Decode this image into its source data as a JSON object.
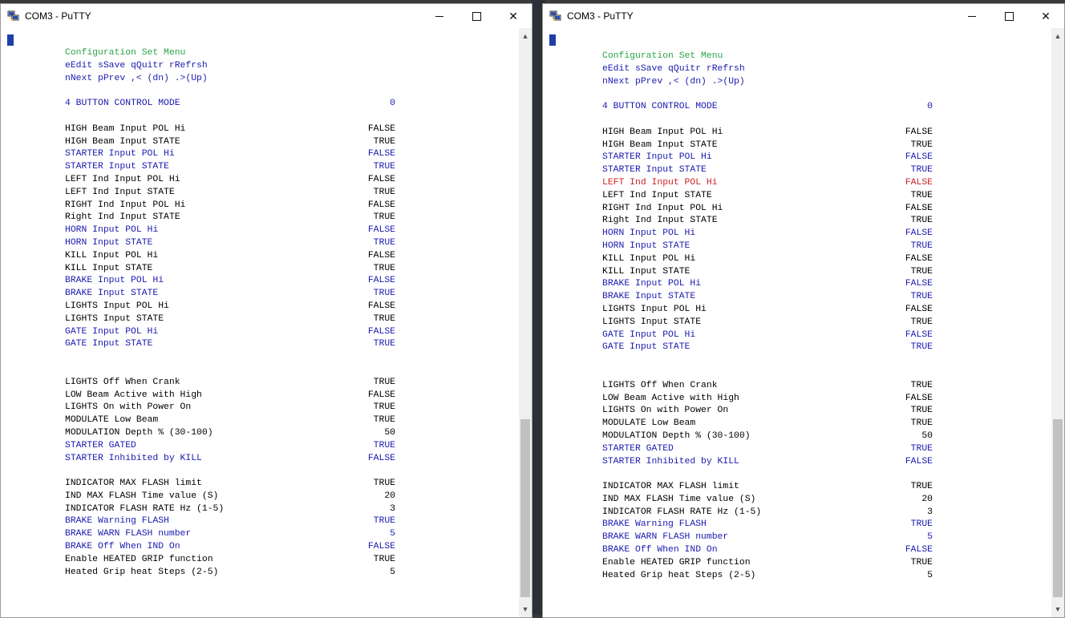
{
  "windows": [
    {
      "title": "COM3 - PuTTY",
      "lines_header": [
        {
          "text": "Configuration Set Menu",
          "color": "green"
        },
        {
          "text": "eEdit sSave qQuitr rRefrsh",
          "color": "blue"
        },
        {
          "text": "nNext pPrev ,< (dn) .>(Up)",
          "color": "blue"
        }
      ],
      "rows": [
        {
          "label": "",
          "value": ""
        },
        {
          "label": "4 BUTTON CONTROL MODE",
          "value": "0",
          "color": "blue"
        },
        {
          "label": "",
          "value": ""
        },
        {
          "label": "HIGH Beam Input POL Hi",
          "value": "FALSE",
          "color": "black"
        },
        {
          "label": "HIGH Beam Input STATE",
          "value": "TRUE",
          "color": "black"
        },
        {
          "label": "STARTER Input POL Hi",
          "value": "FALSE",
          "color": "blue"
        },
        {
          "label": "STARTER Input STATE",
          "value": "TRUE",
          "color": "blue"
        },
        {
          "label": "LEFT Ind Input POL Hi",
          "value": "FALSE",
          "color": "black"
        },
        {
          "label": "LEFT Ind Input STATE",
          "value": "TRUE",
          "color": "black"
        },
        {
          "label": "RIGHT Ind Input POL Hi",
          "value": "FALSE",
          "color": "black"
        },
        {
          "label": "Right Ind Input STATE",
          "value": "TRUE",
          "color": "black"
        },
        {
          "label": "HORN Input POL Hi",
          "value": "FALSE",
          "color": "blue"
        },
        {
          "label": "HORN Input STATE",
          "value": "TRUE",
          "color": "blue"
        },
        {
          "label": "KILL Input POL Hi",
          "value": "FALSE",
          "color": "black"
        },
        {
          "label": "KILL Input STATE",
          "value": "TRUE",
          "color": "black"
        },
        {
          "label": "BRAKE Input POL Hi",
          "value": "FALSE",
          "color": "blue"
        },
        {
          "label": "BRAKE Input STATE",
          "value": "TRUE",
          "color": "blue"
        },
        {
          "label": "LIGHTS Input POL Hi",
          "value": "FALSE",
          "color": "black"
        },
        {
          "label": "LIGHTS Input STATE",
          "value": "TRUE",
          "color": "black"
        },
        {
          "label": "GATE Input POL Hi",
          "value": "FALSE",
          "color": "blue"
        },
        {
          "label": "GATE Input STATE",
          "value": "TRUE",
          "color": "blue"
        },
        {
          "label": "",
          "value": ""
        },
        {
          "label": "",
          "value": ""
        },
        {
          "label": "LIGHTS Off When Crank",
          "value": "TRUE",
          "color": "black"
        },
        {
          "label": "LOW Beam Active with High",
          "value": "FALSE",
          "color": "black"
        },
        {
          "label": "LIGHTS On with Power On",
          "value": "TRUE",
          "color": "black"
        },
        {
          "label": "MODULATE Low Beam",
          "value": "TRUE",
          "color": "black"
        },
        {
          "label": "MODULATION Depth % (30-100)",
          "value": "50",
          "color": "black"
        },
        {
          "label": "STARTER GATED",
          "value": "TRUE",
          "color": "blue"
        },
        {
          "label": "STARTER Inhibited by KILL",
          "value": "FALSE",
          "color": "blue"
        },
        {
          "label": "",
          "value": ""
        },
        {
          "label": "INDICATOR MAX FLASH limit",
          "value": "TRUE",
          "color": "black"
        },
        {
          "label": "IND MAX FLASH Time value (S)",
          "value": "20",
          "color": "black"
        },
        {
          "label": "INDICATOR FLASH RATE Hz (1-5)",
          "value": "3",
          "color": "black"
        },
        {
          "label": "BRAKE Warning FLASH",
          "value": "TRUE",
          "color": "blue"
        },
        {
          "label": "BRAKE WARN FLASH number",
          "value": "5",
          "color": "blue"
        },
        {
          "label": "BRAKE Off When IND On",
          "value": "FALSE",
          "color": "blue"
        },
        {
          "label": "Enable HEATED GRIP function",
          "value": "TRUE",
          "color": "black"
        },
        {
          "label": "Heated Grip heat Steps (2-5)",
          "value": "5",
          "color": "black"
        }
      ]
    },
    {
      "title": "COM3 - PuTTY",
      "lines_header": [
        {
          "text": "Configuration Set Menu",
          "color": "green"
        },
        {
          "text": "eEdit sSave qQuitr rRefrsh",
          "color": "blue"
        },
        {
          "text": "nNext pPrev ,< (dn) .>(Up)",
          "color": "blue"
        }
      ],
      "rows": [
        {
          "label": "",
          "value": ""
        },
        {
          "label": "4 BUTTON CONTROL MODE",
          "value": "0",
          "color": "blue"
        },
        {
          "label": "",
          "value": ""
        },
        {
          "label": "HIGH Beam Input POL Hi",
          "value": "FALSE",
          "color": "black"
        },
        {
          "label": "HIGH Beam Input STATE",
          "value": "TRUE",
          "color": "black"
        },
        {
          "label": "STARTER Input POL Hi",
          "value": "FALSE",
          "color": "blue"
        },
        {
          "label": "STARTER Input STATE",
          "value": "TRUE",
          "color": "blue"
        },
        {
          "label": "LEFT Ind Input POL Hi",
          "value": "FALSE",
          "color": "red"
        },
        {
          "label": "LEFT Ind Input STATE",
          "value": "TRUE",
          "color": "black"
        },
        {
          "label": "RIGHT Ind Input POL Hi",
          "value": "FALSE",
          "color": "black"
        },
        {
          "label": "Right Ind Input STATE",
          "value": "TRUE",
          "color": "black"
        },
        {
          "label": "HORN Input POL Hi",
          "value": "FALSE",
          "color": "blue"
        },
        {
          "label": "HORN Input STATE",
          "value": "TRUE",
          "color": "blue"
        },
        {
          "label": "KILL Input POL Hi",
          "value": "FALSE",
          "color": "black"
        },
        {
          "label": "KILL Input STATE",
          "value": "TRUE",
          "color": "black"
        },
        {
          "label": "BRAKE Input POL Hi",
          "value": "FALSE",
          "color": "blue"
        },
        {
          "label": "BRAKE Input STATE",
          "value": "TRUE",
          "color": "blue"
        },
        {
          "label": "LIGHTS Input POL Hi",
          "value": "FALSE",
          "color": "black"
        },
        {
          "label": "LIGHTS Input STATE",
          "value": "TRUE",
          "color": "black"
        },
        {
          "label": "GATE Input POL Hi",
          "value": "FALSE",
          "color": "blue"
        },
        {
          "label": "GATE Input STATE",
          "value": "TRUE",
          "color": "blue"
        },
        {
          "label": "",
          "value": ""
        },
        {
          "label": "",
          "value": ""
        },
        {
          "label": "LIGHTS Off When Crank",
          "value": "TRUE",
          "color": "black"
        },
        {
          "label": "LOW Beam Active with High",
          "value": "FALSE",
          "color": "black"
        },
        {
          "label": "LIGHTS On with Power On",
          "value": "TRUE",
          "color": "black"
        },
        {
          "label": "MODULATE Low Beam",
          "value": "TRUE",
          "color": "black"
        },
        {
          "label": "MODULATION Depth % (30-100)",
          "value": "50",
          "color": "black"
        },
        {
          "label": "STARTER GATED",
          "value": "TRUE",
          "color": "blue"
        },
        {
          "label": "STARTER Inhibited by KILL",
          "value": "FALSE",
          "color": "blue"
        },
        {
          "label": "",
          "value": ""
        },
        {
          "label": "INDICATOR MAX FLASH limit",
          "value": "TRUE",
          "color": "black"
        },
        {
          "label": "IND MAX FLASH Time value (S)",
          "value": "20",
          "color": "black"
        },
        {
          "label": "INDICATOR FLASH RATE Hz (1-5)",
          "value": "3",
          "color": "black"
        },
        {
          "label": "BRAKE Warning FLASH",
          "value": "TRUE",
          "color": "blue"
        },
        {
          "label": "BRAKE WARN FLASH number",
          "value": "5",
          "color": "blue"
        },
        {
          "label": "BRAKE Off When IND On",
          "value": "FALSE",
          "color": "blue"
        },
        {
          "label": "Enable HEATED GRIP function",
          "value": "TRUE",
          "color": "black"
        },
        {
          "label": "Heated Grip heat Steps (2-5)",
          "value": "5",
          "color": "black"
        }
      ]
    }
  ],
  "icons": {
    "app": "putty-icon",
    "minimize": "minimize-icon",
    "maximize": "maximize-icon",
    "close": "close-icon",
    "scroll_up": "scroll-up-icon",
    "scroll_down": "scroll-down-icon"
  },
  "colors": {
    "green": "#2aa44a",
    "blue": "#1a1ab0",
    "red": "#cc2222",
    "cursor": "#1c3fa8"
  }
}
